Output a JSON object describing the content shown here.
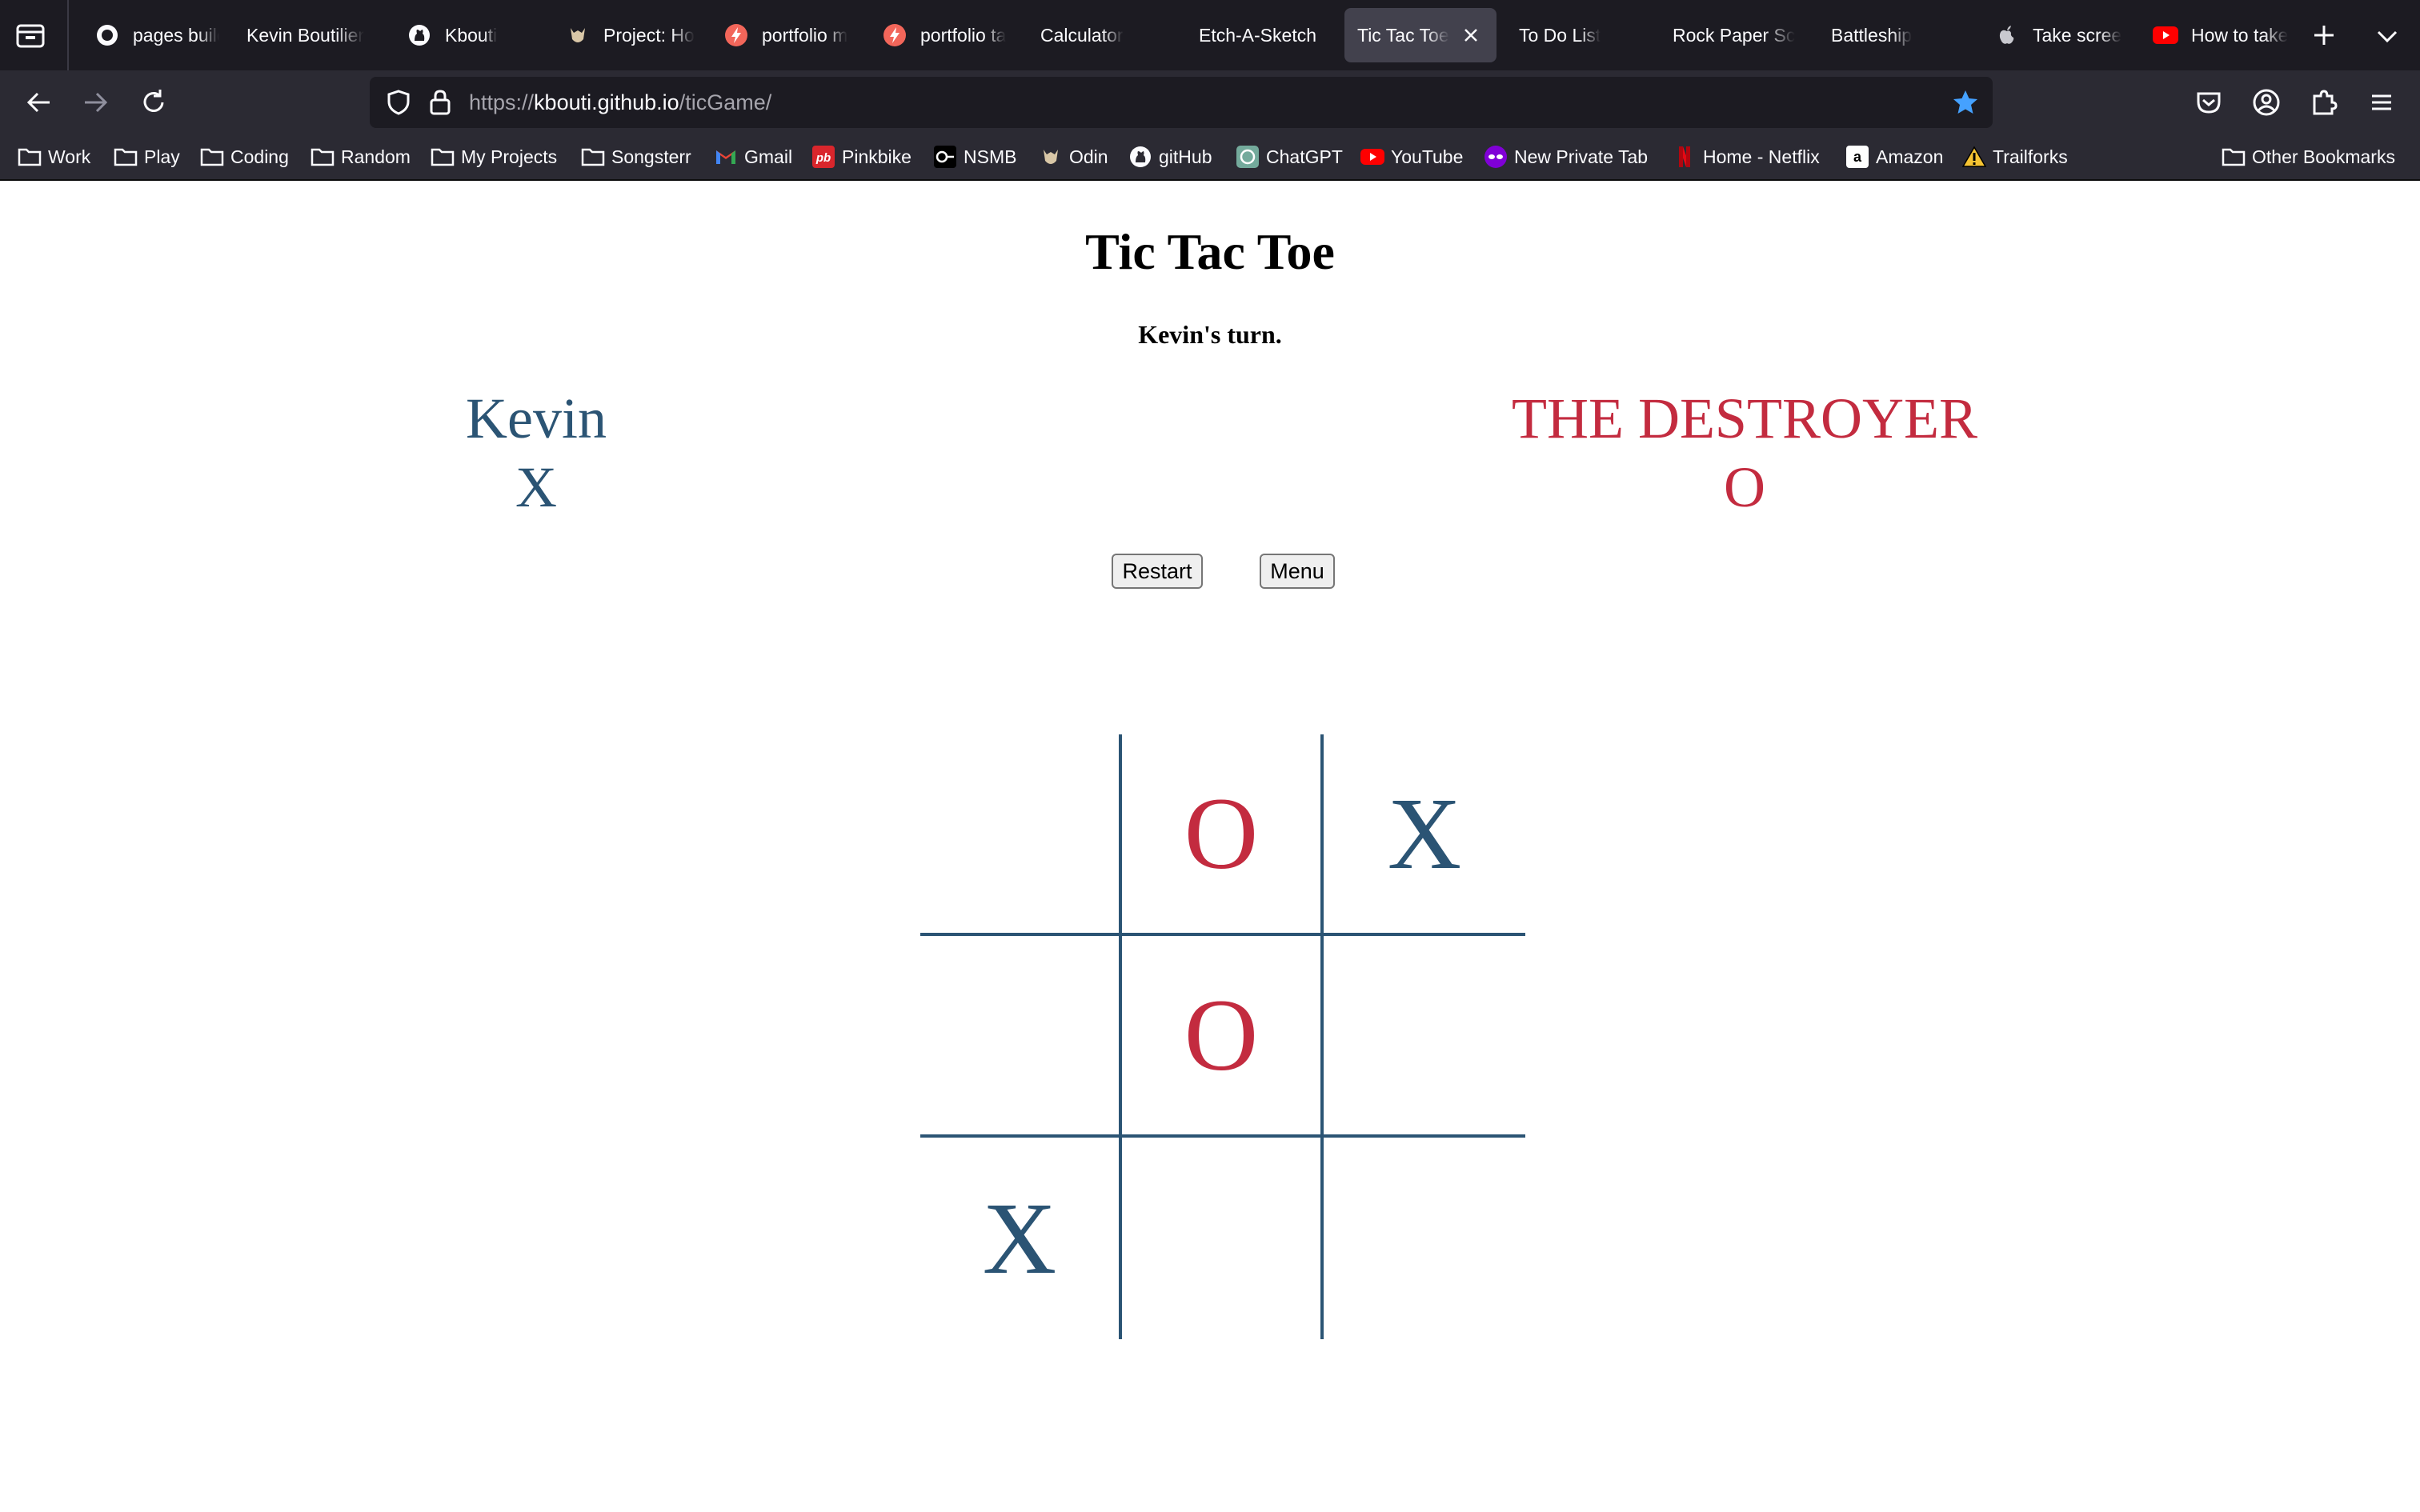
{
  "browser": {
    "tabs": [
      {
        "title": "pages build",
        "icon": "github-icon",
        "active": false
      },
      {
        "title": "Kevin Boutilier",
        "icon": "none",
        "active": false
      },
      {
        "title": "Kbouti",
        "icon": "github-icon",
        "active": false
      },
      {
        "title": "Project: Ho",
        "icon": "odin-icon",
        "active": false
      },
      {
        "title": "portfolio m",
        "icon": "bolt-icon",
        "active": false
      },
      {
        "title": "portfolio ta",
        "icon": "bolt-icon",
        "active": false
      },
      {
        "title": "Calculator",
        "icon": "none",
        "active": false
      },
      {
        "title": "Etch-A-Sketch",
        "icon": "none",
        "active": false
      },
      {
        "title": "Tic Tac Toe",
        "icon": "none",
        "active": true
      },
      {
        "title": "To Do List",
        "icon": "none",
        "active": false
      },
      {
        "title": "Rock Paper Sc",
        "icon": "none",
        "active": false
      },
      {
        "title": "Battleship",
        "icon": "none",
        "active": false
      },
      {
        "title": "Take scree",
        "icon": "apple-icon",
        "active": false
      },
      {
        "title": "How to take",
        "icon": "youtube-icon",
        "active": false
      }
    ],
    "url": {
      "scheme": "https://",
      "host": "kbouti.github.io",
      "path": "/ticGame/"
    },
    "bookmarks": [
      {
        "label": "Work",
        "icon": "folder-icon"
      },
      {
        "label": "Play",
        "icon": "folder-icon"
      },
      {
        "label": "Coding",
        "icon": "folder-icon"
      },
      {
        "label": "Random",
        "icon": "folder-icon"
      },
      {
        "label": "My Projects",
        "icon": "folder-icon"
      },
      {
        "label": "Songsterr",
        "icon": "folder-icon"
      },
      {
        "label": "Gmail",
        "icon": "gmail-icon"
      },
      {
        "label": "Pinkbike",
        "icon": "pinkbike-icon"
      },
      {
        "label": "NSMB",
        "icon": "nsmb-icon"
      },
      {
        "label": "Odin",
        "icon": "odin-icon"
      },
      {
        "label": "gitHub",
        "icon": "github-icon"
      },
      {
        "label": "ChatGPT",
        "icon": "chatgpt-icon"
      },
      {
        "label": "YouTube",
        "icon": "youtube-icon"
      },
      {
        "label": "New Private Tab",
        "icon": "private-mask-icon"
      },
      {
        "label": "Home - Netflix",
        "icon": "netflix-icon"
      },
      {
        "label": "Amazon",
        "icon": "amazon-icon"
      },
      {
        "label": "Trailforks",
        "icon": "trailforks-icon"
      }
    ],
    "other_bookmarks": "Other Bookmarks",
    "colors": {
      "chrome_dark": "#1c1b22",
      "toolbar": "#2b2a33",
      "active_tab": "#42414d",
      "star": "#45a1ff"
    }
  },
  "game": {
    "title": "Tic Tac Toe",
    "status": "Kevin's turn.",
    "player1": {
      "name": "Kevin",
      "mark": "X",
      "color": "#2b5474"
    },
    "player2": {
      "name": "THE DESTROYER",
      "mark": "O",
      "color": "#c32b3f"
    },
    "restart_label": "Restart",
    "menu_label": "Menu",
    "board": [
      "",
      "O",
      "X",
      "",
      "O",
      "",
      "X",
      "",
      ""
    ]
  }
}
